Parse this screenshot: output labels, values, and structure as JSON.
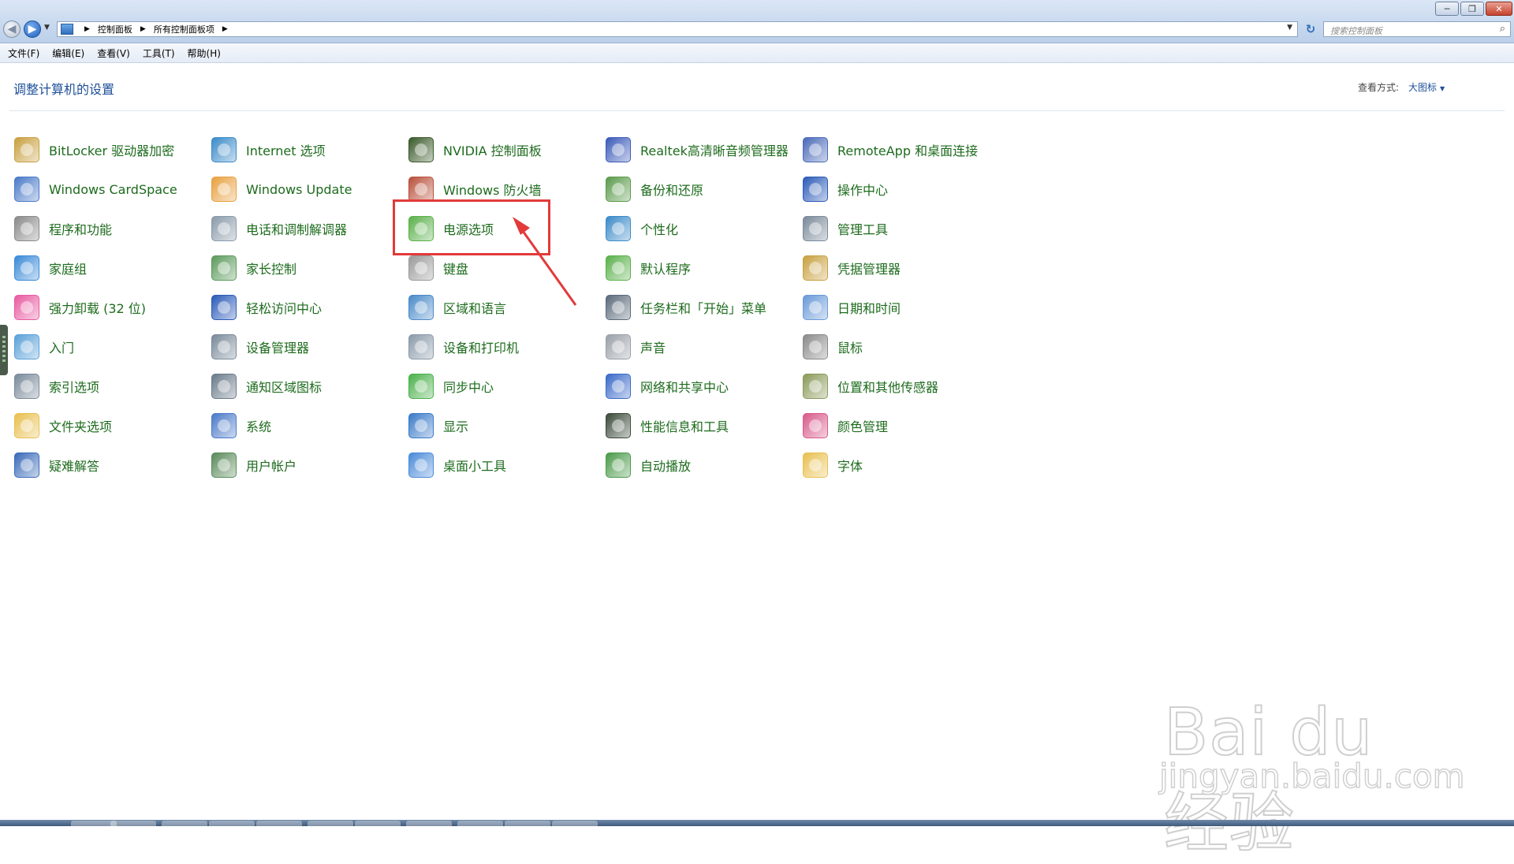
{
  "window": {
    "breadcrumbs": [
      "控制面板",
      "所有控制面板项"
    ],
    "search_placeholder": "搜索控制面板",
    "controls": {
      "minimize": "─",
      "maximize": "❐",
      "close": "✕"
    }
  },
  "menu": [
    "文件(F)",
    "编辑(E)",
    "查看(V)",
    "工具(T)",
    "帮助(H)"
  ],
  "header": {
    "title": "调整计算机的设置",
    "view_label": "查看方式:",
    "view_value": "大图标"
  },
  "colors": {
    "link_green": "#1d6b1d",
    "title_blue": "#1e4f99",
    "highlight_red": "#e23a3a"
  },
  "columns": [
    [
      {
        "label": "BitLocker 驱动器加密",
        "icon": "bitlocker-key-icon",
        "color": "#c8a040"
      },
      {
        "label": "Windows CardSpace",
        "icon": "cardspace-icon",
        "color": "#4a7ac8"
      },
      {
        "label": "程序和功能",
        "icon": "programs-icon",
        "color": "#8a8a8a"
      },
      {
        "label": "家庭组",
        "icon": "homegroup-icon",
        "color": "#3a8ad8"
      },
      {
        "label": "强力卸载 (32 位)",
        "icon": "uninstaller-icon",
        "color": "#e85aa0"
      },
      {
        "label": "入门",
        "icon": "getting-started-icon",
        "color": "#5aa0d8"
      },
      {
        "label": "索引选项",
        "icon": "indexing-icon",
        "color": "#7a8a9a"
      },
      {
        "label": "文件夹选项",
        "icon": "folder-options-icon",
        "color": "#e8c050"
      },
      {
        "label": "疑难解答",
        "icon": "troubleshooting-icon",
        "color": "#3a6ab8"
      }
    ],
    [
      {
        "label": "Internet 选项",
        "icon": "internet-options-icon",
        "color": "#3a8ac8"
      },
      {
        "label": "Windows Update",
        "icon": "windows-update-icon",
        "color": "#e8a040"
      },
      {
        "label": "电话和调制解调器",
        "icon": "phone-modem-icon",
        "color": "#8a9aaa"
      },
      {
        "label": "家长控制",
        "icon": "parental-controls-icon",
        "color": "#5a9a5a"
      },
      {
        "label": "轻松访问中心",
        "icon": "ease-of-access-icon",
        "color": "#2a5ab8"
      },
      {
        "label": "设备管理器",
        "icon": "device-manager-icon",
        "color": "#7a8a9a"
      },
      {
        "label": "通知区域图标",
        "icon": "notification-icons-icon",
        "color": "#6a7a8a"
      },
      {
        "label": "系统",
        "icon": "system-icon",
        "color": "#4a7ac8"
      },
      {
        "label": "用户帐户",
        "icon": "user-accounts-icon",
        "color": "#5a8a5a"
      }
    ],
    [
      {
        "label": "NVIDIA 控制面板",
        "icon": "nvidia-icon",
        "color": "#3a5a2a"
      },
      {
        "label": "Windows 防火墙",
        "icon": "firewall-icon",
        "color": "#b8503a"
      },
      {
        "label": "电源选项",
        "icon": "power-options-icon",
        "color": "#5ab04a"
      },
      {
        "label": "键盘",
        "icon": "keyboard-icon",
        "color": "#9a9a9a"
      },
      {
        "label": "区域和语言",
        "icon": "region-language-icon",
        "color": "#4a8ac8"
      },
      {
        "label": "设备和打印机",
        "icon": "devices-printers-icon",
        "color": "#8a9aaa"
      },
      {
        "label": "同步中心",
        "icon": "sync-center-icon",
        "color": "#4ab04a"
      },
      {
        "label": "显示",
        "icon": "display-icon",
        "color": "#3a7ac8"
      },
      {
        "label": "桌面小工具",
        "icon": "desktop-gadgets-icon",
        "color": "#4a8ad8"
      }
    ],
    [
      {
        "label": "Realtek高清晰音频管理器",
        "icon": "realtek-audio-icon",
        "color": "#3a5ab8"
      },
      {
        "label": "备份和还原",
        "icon": "backup-restore-icon",
        "color": "#5a9a4a"
      },
      {
        "label": "个性化",
        "icon": "personalization-icon",
        "color": "#3a8ac8"
      },
      {
        "label": "默认程序",
        "icon": "default-programs-icon",
        "color": "#5ab04a"
      },
      {
        "label": "任务栏和「开始」菜单",
        "icon": "taskbar-start-menu-icon",
        "color": "#5a6a7a"
      },
      {
        "label": "声音",
        "icon": "sound-icon",
        "color": "#9aa0a8"
      },
      {
        "label": "网络和共享中心",
        "icon": "network-sharing-icon",
        "color": "#3a6ac8"
      },
      {
        "label": "性能信息和工具",
        "icon": "performance-icon",
        "color": "#3a4a3a"
      },
      {
        "label": "自动播放",
        "icon": "autoplay-icon",
        "color": "#4a9a4a"
      }
    ],
    [
      {
        "label": "RemoteApp 和桌面连接",
        "icon": "remoteapp-icon",
        "color": "#4a6ab8"
      },
      {
        "label": "操作中心",
        "icon": "action-center-icon",
        "color": "#2a5ab8"
      },
      {
        "label": "管理工具",
        "icon": "admin-tools-icon",
        "color": "#7a8a9a"
      },
      {
        "label": "凭据管理器",
        "icon": "credential-manager-icon",
        "color": "#c8a040"
      },
      {
        "label": "日期和时间",
        "icon": "date-time-icon",
        "color": "#6a9ad8"
      },
      {
        "label": "鼠标",
        "icon": "mouse-icon",
        "color": "#8a8a8a"
      },
      {
        "label": "位置和其他传感器",
        "icon": "location-sensors-icon",
        "color": "#8a9a5a"
      },
      {
        "label": "颜色管理",
        "icon": "color-management-icon",
        "color": "#d85a8a"
      },
      {
        "label": "字体",
        "icon": "fonts-icon",
        "color": "#e8c050"
      }
    ]
  ],
  "watermark": {
    "brand": "Bai du 经验",
    "url": "jingyan.baidu.com"
  }
}
